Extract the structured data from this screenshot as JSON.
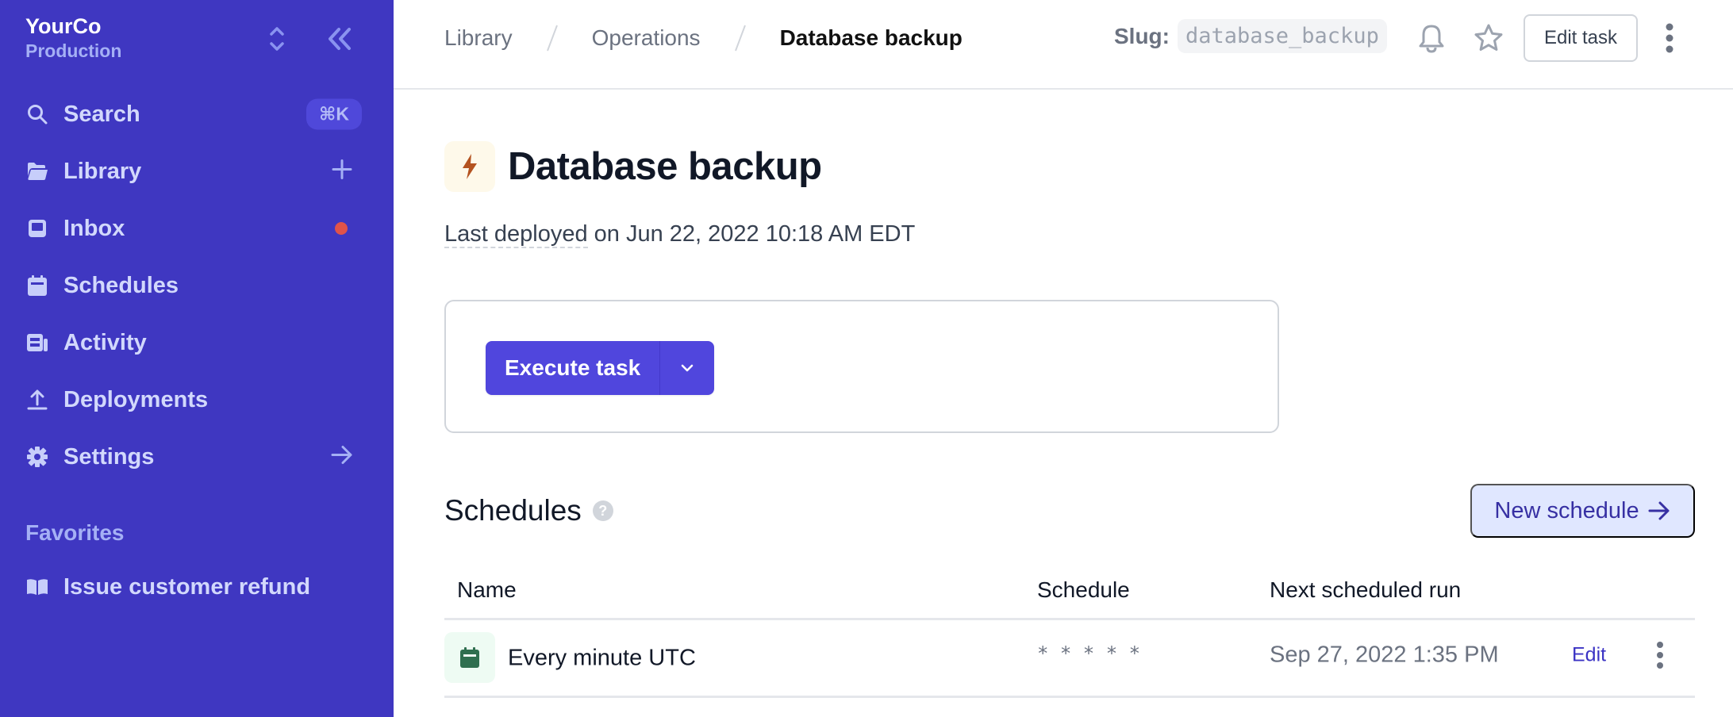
{
  "sidebar": {
    "org_name": "YourCo",
    "org_env": "Production",
    "nav": [
      {
        "label": "Search",
        "icon": "search-icon",
        "shortcut": "⌘K"
      },
      {
        "label": "Library",
        "icon": "folder-icon",
        "action": "+"
      },
      {
        "label": "Inbox",
        "icon": "inbox-icon",
        "has_unread": true
      },
      {
        "label": "Schedules",
        "icon": "calendar-icon"
      },
      {
        "label": "Activity",
        "icon": "activity-icon"
      },
      {
        "label": "Deployments",
        "icon": "upload-icon"
      },
      {
        "label": "Settings",
        "icon": "gear-icon",
        "action": "→"
      }
    ],
    "favorites_heading": "Favorites",
    "favorites": [
      {
        "label": "Issue customer refund",
        "icon": "book-icon"
      }
    ]
  },
  "topbar": {
    "breadcrumbs": [
      "Library",
      "Operations",
      "Database backup"
    ],
    "slug_label": "Slug:",
    "slug_value": "database_backup",
    "edit_task_label": "Edit task"
  },
  "task": {
    "title": "Database backup",
    "deployed_prefix": "Last deployed",
    "deployed_suffix": " on Jun 22, 2022 10:18 AM EDT",
    "execute_label": "Execute task"
  },
  "schedules": {
    "heading": "Schedules",
    "help_glyph": "?",
    "new_label": "New schedule",
    "columns": [
      "Name",
      "Schedule",
      "Next scheduled run"
    ],
    "rows": [
      {
        "name": "Every minute UTC",
        "cron": "* * * * *",
        "next_run": "Sep 27, 2022 1:35 PM",
        "edit_label": "Edit"
      }
    ]
  },
  "colors": {
    "sidebar_bg": "#3F37C1",
    "primary": "#5046DD",
    "notification_dot": "#E0534A",
    "title_icon_accent": "#B45320",
    "schedule_icon_accent": "#2F6F4F"
  }
}
